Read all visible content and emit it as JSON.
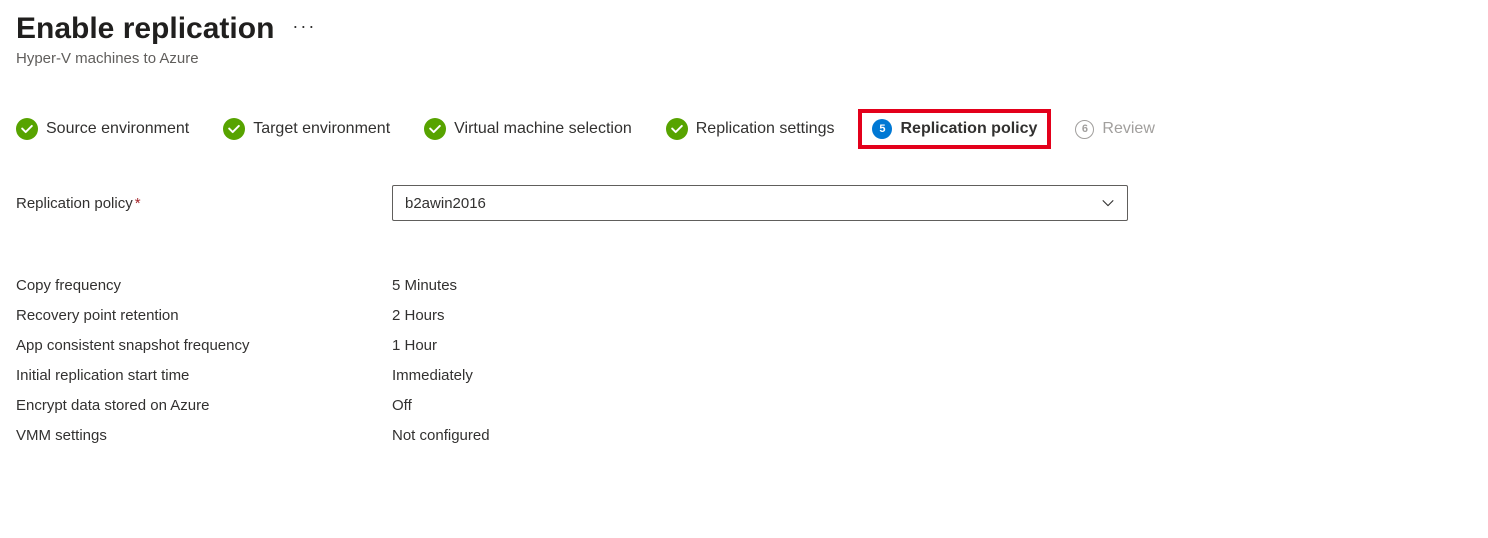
{
  "header": {
    "title": "Enable replication",
    "subtitle": "Hyper-V machines to Azure"
  },
  "steps": [
    {
      "label": "Source environment",
      "state": "done"
    },
    {
      "label": "Target environment",
      "state": "done"
    },
    {
      "label": "Virtual machine selection",
      "state": "done"
    },
    {
      "label": "Replication settings",
      "state": "done"
    },
    {
      "label": "Replication policy",
      "state": "active",
      "num": "5"
    },
    {
      "label": "Review",
      "state": "future",
      "num": "6"
    }
  ],
  "form": {
    "policy_label": "Replication policy",
    "policy_value": "b2awin2016"
  },
  "details": [
    {
      "label": "Copy frequency",
      "value": "5 Minutes"
    },
    {
      "label": "Recovery point retention",
      "value": "2 Hours"
    },
    {
      "label": "App consistent snapshot frequency",
      "value": "1 Hour"
    },
    {
      "label": "Initial replication start time",
      "value": "Immediately"
    },
    {
      "label": "Encrypt data stored on Azure",
      "value": "Off"
    },
    {
      "label": "VMM settings",
      "value": "Not configured"
    }
  ]
}
